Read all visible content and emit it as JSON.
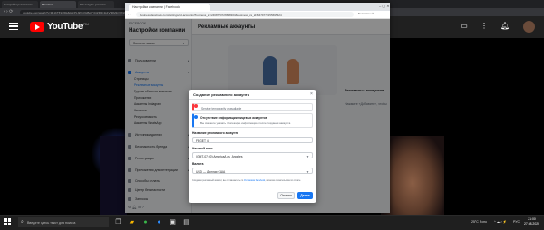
{
  "outer_browser": {
    "tabs": [
      "Настройки рекламного...",
      "Реклама",
      "Как создать рекламн...",
      "Бизнес-менеджер",
      "Настройки",
      "YouTube",
      "Video"
    ],
    "url": "youtube.com/watch?v=9K1bTfNn2Dk&list=PLbPnC6cBgIYrCtZR1C1k1V3AM1QYXkBPN"
  },
  "youtube": {
    "logo_text": "YouTube",
    "region": "RU",
    "icons": [
      "menu-icon",
      "upload-icon",
      "apps-icon",
      "notifications-icon"
    ]
  },
  "inner_browser": {
    "tab_title": "Настройки компании | Facebook",
    "url": "business.facebook.com/settings/ad-accounts?business_id=2468770726538303&business_cs_id=8479773155695424",
    "extra": "Бесплатный"
  },
  "sidebar": {
    "brand": "FACEBOOK",
    "title": "Настройки компании",
    "account": "Золотое звено",
    "items": [
      {
        "label": "Пользователи"
      },
      {
        "label": "Аккаунты"
      },
      {
        "label": "Источники данных"
      },
      {
        "label": "Безопасность бренда"
      },
      {
        "label": "Регистрации"
      },
      {
        "label": "Приложения для интеграции"
      },
      {
        "label": "Способы оплаты"
      },
      {
        "label": "Центр безопасности"
      },
      {
        "label": "Запросы"
      }
    ],
    "sub_items": [
      "Страницы",
      "Рекламные аккаунты",
      "Группы объектов компании",
      "Приложения",
      "Аккаунты Instagram",
      "Каталоги",
      "Ресурсоемкость",
      "Аккаунты WhatsApp"
    ]
  },
  "main": {
    "title": "Рекламные аккаунты",
    "empty_title": "Рекламных аккаунтов",
    "empty_text": "Нажмите «Добавить», чтобы"
  },
  "modal": {
    "title": "Создание рекламного аккаунта",
    "error_text": "Service temporarily unavailable",
    "info_title": "Отсутствие информации лицевых аккаунтов",
    "info_text": "Вы сможете указать платежную информацию после создания аккаунта",
    "name_label": "Название рекламного аккаунта",
    "name_value": "FBGET 4",
    "tz_label": "Часовой пояс",
    "tz_value": "(GMT-07:00) America/Los_Angeles",
    "currency_label": "Валюта",
    "currency_value": "USD — Доллар США",
    "terms_prefix": "Создавая рекламный аккаунт, вы соглашаетесь со ",
    "terms_link": "Условиями Facebook",
    "terms_suffix": ", включая обязательства по оплате.",
    "cancel": "Отмена",
    "next": "Далее"
  },
  "taskbar": {
    "search_placeholder": "Введите здесь текст для поиска",
    "tray_text": "25°C Ясно",
    "lang": "РУС",
    "time": "21:00",
    "date": "27.08.2020"
  }
}
